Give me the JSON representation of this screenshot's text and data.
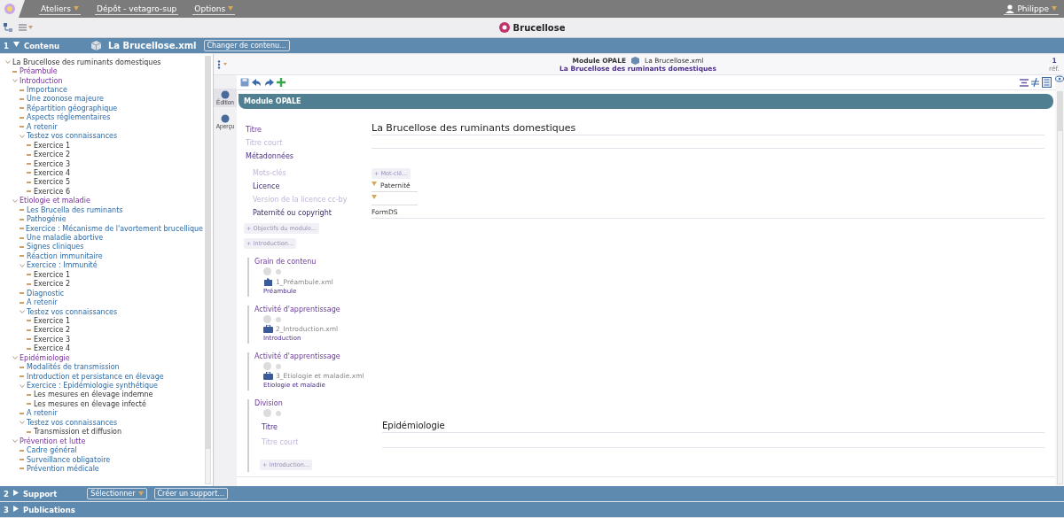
{
  "topbar": {
    "menus": [
      {
        "label": "Ateliers",
        "caret": true
      },
      {
        "label": "Dépôt - vetagro-sup",
        "caret": false
      },
      {
        "label": "Options",
        "caret": true
      }
    ],
    "user": "Philippe"
  },
  "toolbar": {
    "title": "Brucellose"
  },
  "content_bar": {
    "number": "1",
    "label": "Contenu",
    "expanded": true,
    "file": "La Brucellose.xml",
    "button": "Changer de contenu..."
  },
  "tree": [
    {
      "label": "La Brucellose des ruminants domestiques",
      "expanded": true,
      "children": [
        {
          "label": "Préambule"
        },
        {
          "label": "Introduction",
          "expanded": true,
          "children": [
            {
              "label": "Importance"
            },
            {
              "label": "Une zoonose majeure"
            },
            {
              "label": "Répartition géographique"
            },
            {
              "label": "Aspects réglementaires"
            },
            {
              "label": "A retenir"
            },
            {
              "label": "Testez vos connaissances",
              "expanded": true,
              "children": [
                {
                  "label": "Exercice 1"
                },
                {
                  "label": "Exercice 2"
                },
                {
                  "label": "Exercice 3"
                },
                {
                  "label": "Exercice 4"
                },
                {
                  "label": "Exercice 5"
                },
                {
                  "label": "Exercice 6"
                }
              ]
            }
          ]
        },
        {
          "label": "Etiologie et maladie",
          "expanded": true,
          "children": [
            {
              "label": "Les Brucella des ruminants"
            },
            {
              "label": "Pathogénie"
            },
            {
              "label": "Exercice : Mécanisme de l'avortement brucellique"
            },
            {
              "label": "Une maladie abortive"
            },
            {
              "label": "Signes cliniques"
            },
            {
              "label": "Réaction immunitaire"
            },
            {
              "label": "Exercice : Immunité",
              "expanded": true,
              "children": [
                {
                  "label": "Exercice 1"
                },
                {
                  "label": "Exercice 2"
                }
              ]
            },
            {
              "label": "Diagnostic"
            },
            {
              "label": "A retenir"
            },
            {
              "label": "Testez vos connaissances",
              "expanded": true,
              "children": [
                {
                  "label": "Exercice 1"
                },
                {
                  "label": "Exercice 2"
                },
                {
                  "label": "Exercice 3"
                },
                {
                  "label": "Exercice 4"
                }
              ]
            }
          ]
        },
        {
          "label": "Epidémiologie",
          "expanded": true,
          "children": [
            {
              "label": "Modalités de transmission"
            },
            {
              "label": "Introduction et persistance en élevage"
            },
            {
              "label": "Exercice : Epidémiologie synthétique",
              "expanded": true,
              "children": [
                {
                  "label": "Les mesures en élevage indemne"
                },
                {
                  "label": "Les mesures en élevage infecté"
                }
              ]
            },
            {
              "label": "A retenir"
            },
            {
              "label": "Testez vos connaissances",
              "expanded": true,
              "children": [
                {
                  "label": "Transmission et diffusion"
                }
              ]
            }
          ]
        },
        {
          "label": "Prévention et lutte",
          "expanded": true,
          "children": [
            {
              "label": "Cadre général"
            },
            {
              "label": "Surveillance obligatoire"
            },
            {
              "label": "Prévention médicale"
            }
          ]
        }
      ]
    }
  ],
  "editor": {
    "header_type": "Module OPALE",
    "header_file": "La Brucellose.xml",
    "header_title": "La Brucellose des ruminants domestiques",
    "refs_count": "1",
    "refs_label": "réf.",
    "side_tabs": [
      {
        "label": "Édition",
        "selected": true
      },
      {
        "label": "Aperçu",
        "selected": false
      }
    ],
    "module_title": "Module OPALE",
    "fields": [
      {
        "label": "Titre",
        "kind": "text",
        "filled": true,
        "indent": false,
        "value": "La Brucellose des ruminants domestiques"
      },
      {
        "label": "Titre court",
        "kind": "text",
        "filled": false,
        "indent": false
      },
      {
        "label": "Métadonnées",
        "kind": "group",
        "filled": true,
        "indent": false
      },
      {
        "label": "Mots-clés",
        "kind": "add",
        "filled": false,
        "indent": true,
        "value": "+ Mot-clé..."
      },
      {
        "label": "Licence",
        "kind": "select",
        "filled": true,
        "indent": true,
        "value": "Paternité"
      },
      {
        "label": "Version de la licence cc-by",
        "kind": "select",
        "filled": false,
        "indent": true
      },
      {
        "label": "Paternité ou copyright",
        "kind": "line",
        "filled": true,
        "indent": true,
        "value": "FormDS"
      }
    ],
    "add_buttons": [
      "+ Objectifs du module...",
      "+ Introduction..."
    ],
    "blocks": [
      {
        "label": "Grain de contenu",
        "kind": "grain",
        "file": "1_Préambule.xml",
        "title": "Préambule"
      },
      {
        "label": "Activité d'apprentissage",
        "kind": "activity",
        "file": "2_Introduction.xml",
        "title": "Introduction"
      },
      {
        "label": "Activité d'apprentissage",
        "kind": "activity",
        "file": "3_Etiologie et maladie.xml",
        "title": "Etiologie et maladie"
      }
    ],
    "division": {
      "label": "Division",
      "title_label": "Titre",
      "title_value": "Epidémiologie",
      "short_label": "Titre court",
      "add_button": "+ Introduction..."
    }
  },
  "support_bar": {
    "number": "2",
    "label": "Support",
    "expanded": false,
    "select": "Sélectionner",
    "button": "Créer un support..."
  },
  "publications_bar": {
    "number": "3",
    "label": "Publications",
    "expanded": false
  }
}
